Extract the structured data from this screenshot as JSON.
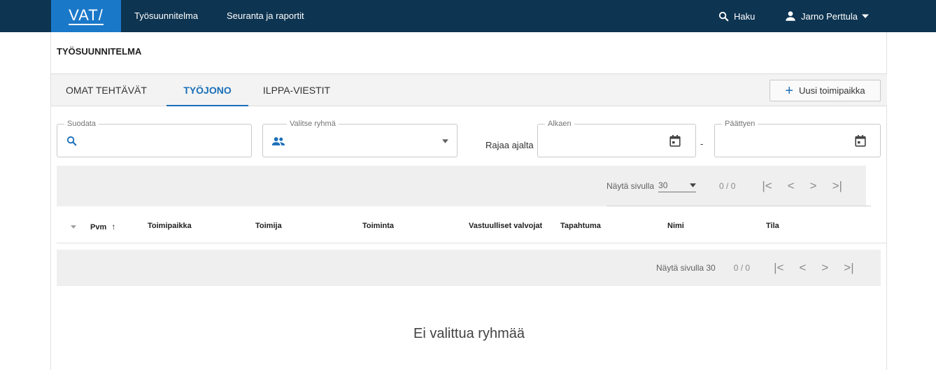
{
  "topbar": {
    "logo": "VAT/",
    "nav": [
      "Työsuunnitelma",
      "Seuranta ja raportit"
    ],
    "search_label": "Haku",
    "user_name": "Jarno Perttula"
  },
  "page": {
    "title": "TYÖSUUNNITELMA",
    "tabs": [
      "OMAT TEHTÄVÄT",
      "TYÖJONO",
      "ILPPA-VIESTIT"
    ],
    "active_tab": "TYÖJONO",
    "new_button_label": "Uusi toimipaikka"
  },
  "filters": {
    "filter_label": "Suodata",
    "group_label": "Valitse ryhmä",
    "range_label": "Rajaa ajalta",
    "start_label": "Alkaen",
    "end_label": "Päättyen",
    "separator": "-"
  },
  "pager_top": {
    "per_page_label": "Näytä sivulla",
    "per_page_value": "30",
    "range": "0 / 0"
  },
  "table": {
    "columns": [
      "Pvm",
      "Toimipaikka",
      "Toimija",
      "Toiminta",
      "Vastuulliset valvojat",
      "Tapahtuma",
      "Nimi",
      "Tila"
    ]
  },
  "pager_bottom": {
    "per_page_label": "Näytä sivulla 30",
    "range": "0 / 0"
  },
  "empty_message": "Ei valittua ryhmää",
  "colors": {
    "topbar": "#0d3451",
    "logo_bg": "#1a78c9",
    "accent": "#1a6fb8"
  }
}
